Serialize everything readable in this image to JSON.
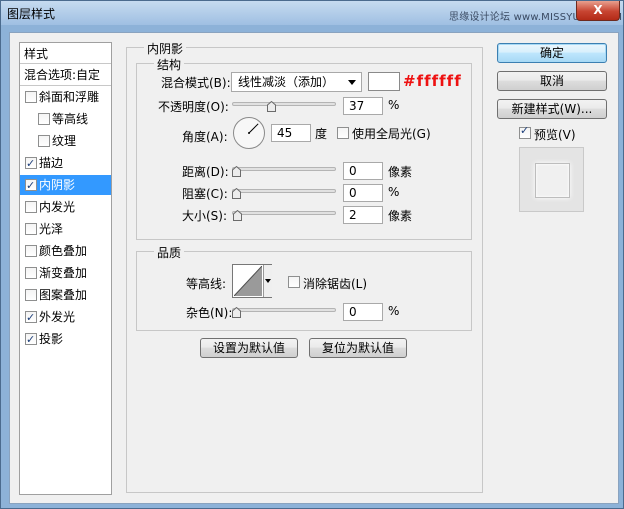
{
  "window": {
    "title": "图层样式",
    "watermark": "思缘设计论坛 www.MISSYUAN.COM",
    "close_glyph": "X"
  },
  "left_panel": {
    "header": "样式",
    "blend_options": "混合选项:自定",
    "items": [
      {
        "label": "斜面和浮雕",
        "checked": false,
        "sub": false
      },
      {
        "label": "等高线",
        "checked": false,
        "sub": true
      },
      {
        "label": "纹理",
        "checked": false,
        "sub": true
      },
      {
        "label": "描边",
        "checked": true,
        "sub": false
      },
      {
        "label": "内阴影",
        "checked": true,
        "sub": false,
        "selected": true
      },
      {
        "label": "内发光",
        "checked": false,
        "sub": false
      },
      {
        "label": "光泽",
        "checked": false,
        "sub": false
      },
      {
        "label": "颜色叠加",
        "checked": false,
        "sub": false
      },
      {
        "label": "渐变叠加",
        "checked": false,
        "sub": false
      },
      {
        "label": "图案叠加",
        "checked": false,
        "sub": false
      },
      {
        "label": "外发光",
        "checked": true,
        "sub": false
      },
      {
        "label": "投影",
        "checked": true,
        "sub": false
      }
    ]
  },
  "inner_shadow": {
    "title": "内阴影",
    "structure": {
      "title": "结构",
      "blend_mode_label": "混合模式(B):",
      "blend_mode_value": "线性减淡（添加）",
      "color": "#ffffff",
      "color_annotation": "#ffffff",
      "opacity_label": "不透明度(O):",
      "opacity_value": "37",
      "opacity_unit": "%",
      "angle_label": "角度(A):",
      "angle_value": "45",
      "angle_unit": "度",
      "global_light_label": "使用全局光(G)",
      "global_light_checked": false,
      "distance_label": "距离(D):",
      "distance_value": "0",
      "distance_unit": "像素",
      "choke_label": "阻塞(C):",
      "choke_value": "0",
      "choke_unit": "%",
      "size_label": "大小(S):",
      "size_value": "2",
      "size_unit": "像素"
    },
    "quality": {
      "title": "品质",
      "contour_label": "等高线:",
      "anti_alias_label": "消除锯齿(L)",
      "anti_alias_checked": false,
      "noise_label": "杂色(N):",
      "noise_value": "0",
      "noise_unit": "%"
    },
    "make_default": "设置为默认值",
    "reset_default": "复位为默认值"
  },
  "buttons": {
    "ok": "确定",
    "cancel": "取消",
    "new_style": "新建样式(W)...",
    "preview_label": "预览(V)",
    "preview_checked": true
  }
}
